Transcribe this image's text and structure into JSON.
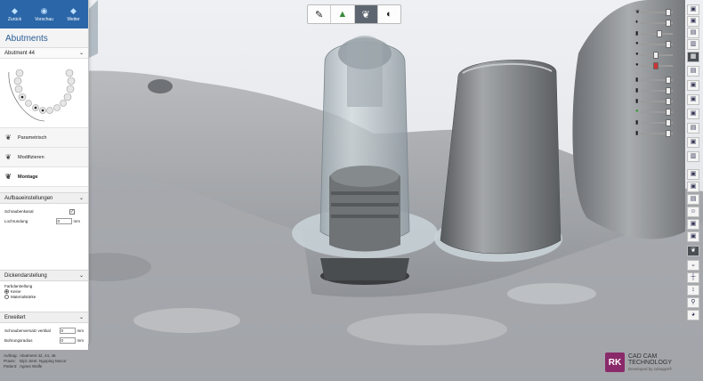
{
  "nav": {
    "back": "Zurück",
    "preview": "Vorschau",
    "next": "Weiter"
  },
  "panel": {
    "title": "Abutments",
    "selected": "Abutment 44",
    "steps": [
      "Parametrisch",
      "Modifizieren",
      "Montage"
    ]
  },
  "sections": {
    "build": {
      "title": "Aufbaueinstellungen",
      "screw_channel": "Schraubenkanal",
      "hole_round": "Lochrundung",
      "hole_round_value": "0",
      "unit": "mm"
    },
    "thickness": {
      "title": "Dickendarstellung",
      "color_label": "Farbdarstellung",
      "opt1": "Keine",
      "opt2": "Materialstärke"
    },
    "extended": {
      "title": "Erweitert",
      "screw_offset": "Schraubenversatz vertikal",
      "screw_offset_value": "0",
      "drill_radius": "Bohrungsradius",
      "drill_radius_value": "0",
      "unit": "mm"
    }
  },
  "info": {
    "order_k": "Auftrag:",
    "order_v": "Abutment 42, 44, 46",
    "practice_k": "Praxis:",
    "practice_v": "Dipl.-Zent. Ngoping Mocur",
    "patient_k": "Patient:",
    "patient_v": "Agnes Wolfe"
  },
  "logo": {
    "mark": "RK",
    "line1": "CAD CAM",
    "line2": "TECHNOLOGY",
    "line3": "Developed by zahapps®"
  },
  "colors": {
    "accent": "#2a66a8",
    "logo": "#8a2a6a"
  }
}
